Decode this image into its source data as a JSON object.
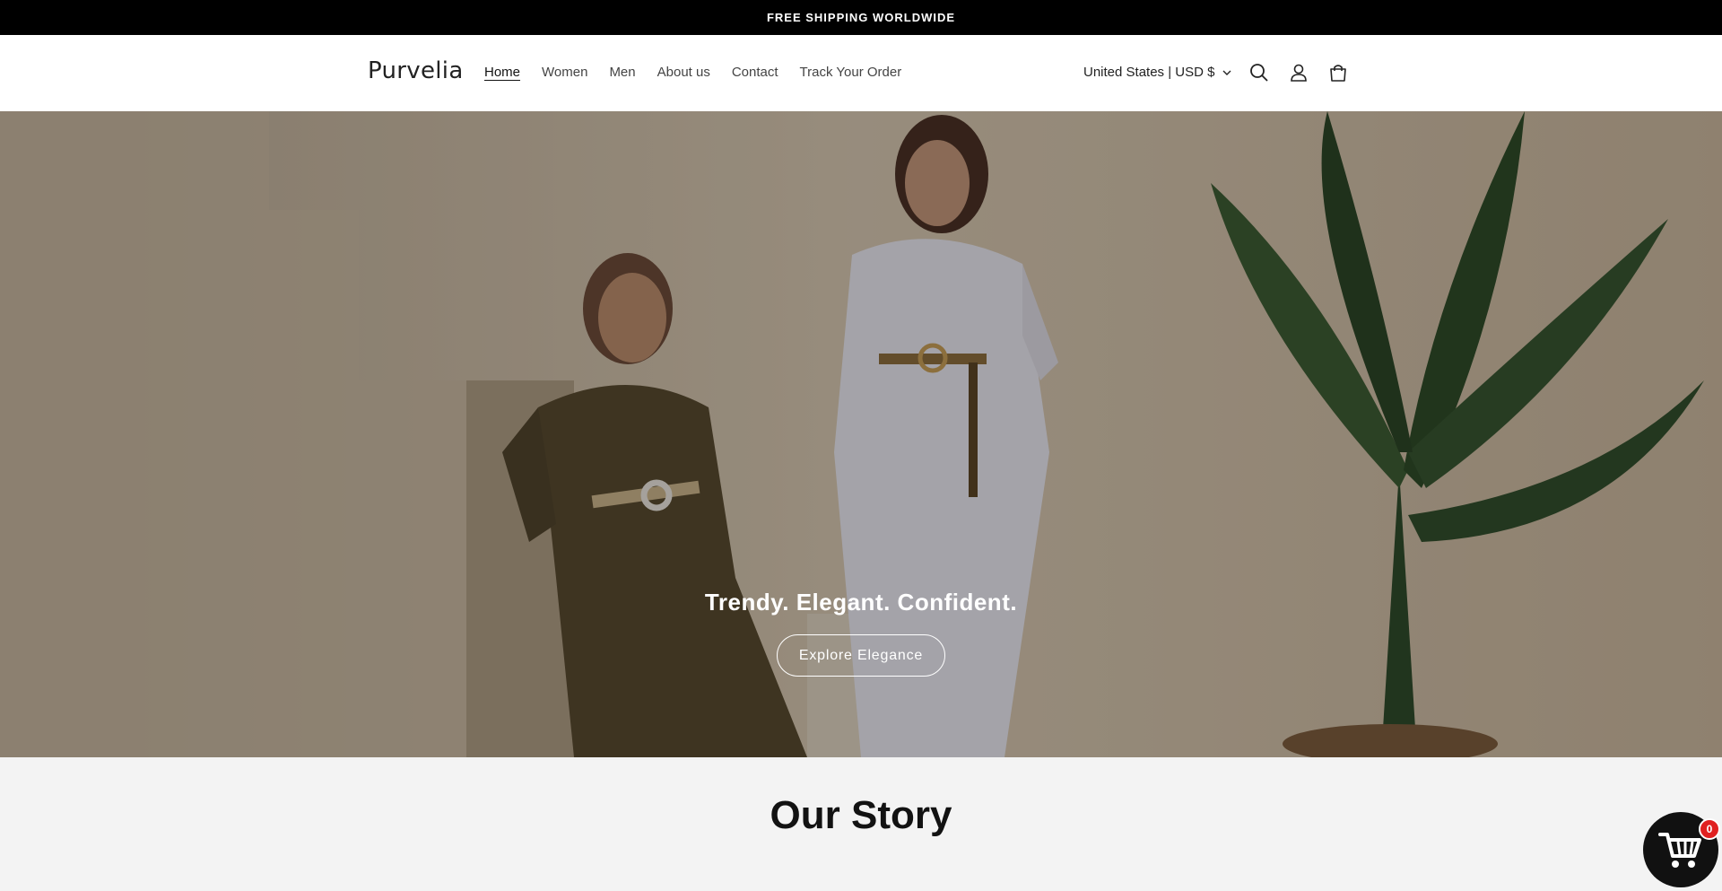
{
  "announcement": {
    "text": "FREE SHIPPING WORLDWIDE"
  },
  "header": {
    "logo": "Purvelia",
    "nav": [
      {
        "label": "Home",
        "active": true
      },
      {
        "label": "Women",
        "active": false
      },
      {
        "label": "Men",
        "active": false
      },
      {
        "label": "About us",
        "active": false
      },
      {
        "label": "Contact",
        "active": false
      },
      {
        "label": "Track Your Order",
        "active": false
      }
    ],
    "locale": "United States | USD $",
    "icons": [
      "search-icon",
      "account-icon",
      "cart-icon"
    ]
  },
  "hero": {
    "heading": "Trendy. Elegant. Confident.",
    "button_label": "Explore Elegance"
  },
  "story": {
    "title": "Our Story"
  },
  "floating_cart": {
    "count": "0",
    "icon": "shopping-cart-icon"
  },
  "colors": {
    "announcement_bg": "#000000",
    "header_bg": "#ffffff",
    "story_bg": "#f3f3f3",
    "badge": "#e02020"
  }
}
